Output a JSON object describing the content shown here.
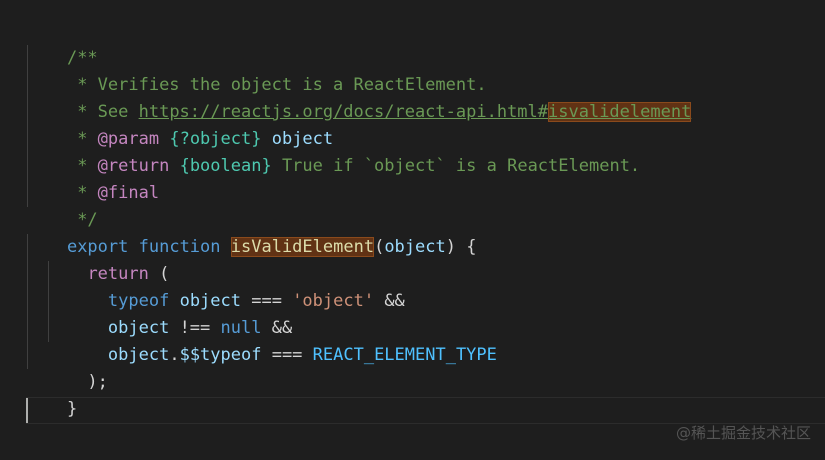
{
  "editor": {
    "lines": {
      "l1": {
        "open": "/**"
      },
      "l2": {
        "text": " * Verifies the object is a ReactElement."
      },
      "l3": {
        "prefix": " * See ",
        "url_base": "https://reactjs.org/docs/react-api.html#",
        "url_anchor": "isvalidelement"
      },
      "l4": {
        "star": " * ",
        "tag": "@param",
        "sp1": " ",
        "type": "{?object}",
        "sp2": " ",
        "name": "object"
      },
      "l5": {
        "star": " * ",
        "tag": "@return",
        "sp1": " ",
        "type": "{boolean}",
        "desc": " True if `object` is a ReactElement."
      },
      "l6": {
        "star": " * ",
        "tag": "@final"
      },
      "l7": {
        "close": " */"
      },
      "l8": {
        "kw1": "export",
        "sp1": " ",
        "kw2": "function",
        "sp2": " ",
        "fn": "isValidElement",
        "p1": "(",
        "param": "object",
        "p2": ") {"
      },
      "l9": {
        "indent": "  ",
        "kw": "return",
        "rest": " ("
      },
      "l10": {
        "indent": "    ",
        "kw": "typeof",
        "sp": " ",
        "var": "object",
        "op": " === ",
        "str": "'object'",
        "op2": " &&"
      },
      "l11": {
        "indent": "    ",
        "var": "object",
        "op": " !== ",
        "kw": "null",
        "op2": " &&"
      },
      "l12": {
        "indent": "    ",
        "var": "object",
        "dot": ".",
        "prop": "$$typeof",
        "op": " === ",
        "const": "REACT_ELEMENT_TYPE"
      },
      "l13": {
        "text": "  );"
      },
      "l14": {
        "text": "}"
      }
    }
  },
  "watermark": "@稀土掘金技术社区",
  "colors": {
    "background": "#1e1e1e",
    "comment": "#6a9955",
    "keyword": "#569cd6",
    "control_keyword": "#c586c0",
    "function": "#dcdcaa",
    "variable": "#9cdcfe",
    "string": "#ce9178",
    "constant": "#4fc1ff",
    "type": "#4ec9b0",
    "highlight": "#613214"
  }
}
